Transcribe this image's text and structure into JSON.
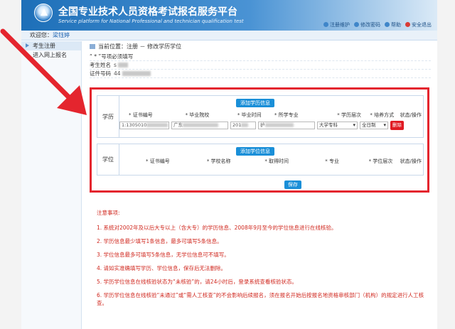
{
  "header": {
    "title": "全国专业技术人员资格考试报名服务平台",
    "subtitle": "Service platform for National Professional and technician qualification test",
    "links": [
      {
        "icon": "user-icon",
        "label": "注册维护"
      },
      {
        "icon": "key-icon",
        "label": "修改密码"
      },
      {
        "icon": "help-icon",
        "label": "帮助"
      },
      {
        "icon": "logout-icon",
        "label": "安全退出"
      }
    ]
  },
  "welcome": {
    "prefix": "欢迎您：",
    "user": "梁钰婷"
  },
  "sidebar": {
    "items": [
      {
        "label": "考生注册"
      },
      {
        "label": "进入网上报名"
      }
    ]
  },
  "breadcrumb": "当前位置：注册 － 修改学历学位",
  "info": {
    "note": "“ * ”号项必须填写",
    "name_label": "考生姓名",
    "name_value": "s",
    "id_label": "证件号码",
    "id_value": "44"
  },
  "education": {
    "label": "学历",
    "add_button": "添加学历信息",
    "columns": [
      "* 证书编号",
      "* 毕业院校",
      "* 毕业时间",
      "* 所学专业",
      "* 学历层次",
      "* 培养方式",
      "状态/操作"
    ],
    "row": {
      "cert_no": "1:1305010",
      "school": "广东",
      "grad_time": "201",
      "major": "护",
      "level": "大学专科",
      "mode": "全日制",
      "delete_button": "删除"
    }
  },
  "degree": {
    "label": "学位",
    "add_button": "添加学位信息",
    "columns": [
      "* 证书编号",
      "* 学校名称",
      "* 取得时间",
      "* 专业",
      "* 学位层次",
      "状态/操作"
    ]
  },
  "save_button": "保存",
  "notes": {
    "title": "注意事项:",
    "items": [
      "1. 系统对2002年及以后大专以上（含大专）的学历信息、2008年9月至今的学位信息进行在线核验。",
      "2. 学历信息最少填写1条信息，最多可填写5条信息。",
      "3. 学位信息最多可填写5条信息，无学位信息可不填写。",
      "4. 请如实准确填写学历、学位信息，保存后无法删除。",
      "5. 学历学位信息在线核验状态为“未核验”的，请24小时后，登录系统查看核验状态。",
      "6. 学历学位信息在线核验“未通过”或“需人工核查”的不会影响后续报名，须在报名开始后按报名地资格审核部门（机构）的规定进行人工核查。"
    ]
  },
  "colors": {
    "highlight": "#e4252e",
    "header": "#1d6fb8",
    "button": "#1a8fd8",
    "delete": "#e01b23"
  }
}
